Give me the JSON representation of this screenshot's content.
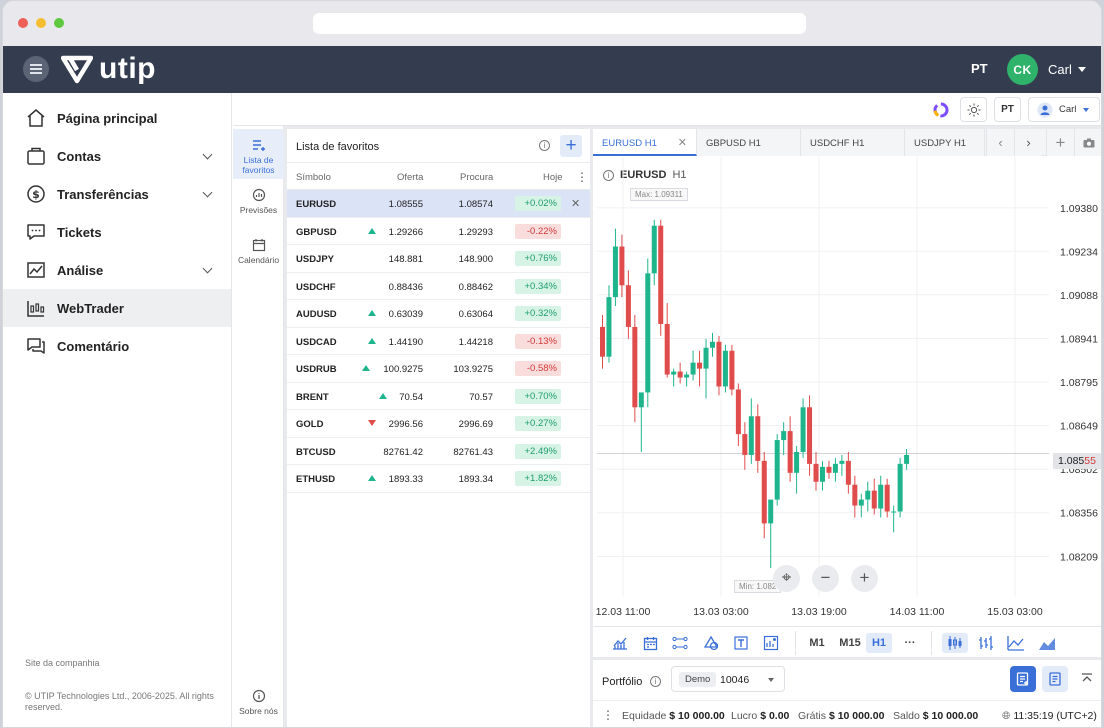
{
  "header": {
    "brand": "utip",
    "lang": "PT",
    "avatar_initials": "CK",
    "user": "Carl"
  },
  "sidebar": {
    "items": [
      {
        "label": "Página principal",
        "icon": "home-icon",
        "expandable": false
      },
      {
        "label": "Contas",
        "icon": "wallet-icon",
        "expandable": true
      },
      {
        "label": "Transferências",
        "icon": "dollar-icon",
        "expandable": true
      },
      {
        "label": "Tickets",
        "icon": "chat-icon",
        "expandable": false
      },
      {
        "label": "Análise",
        "icon": "analytics-icon",
        "expandable": true
      },
      {
        "label": "WebTrader",
        "icon": "webtrader-icon",
        "expandable": false,
        "active": true
      },
      {
        "label": "Comentário",
        "icon": "comment-icon",
        "expandable": false
      }
    ],
    "footer_link": "Site da companhia",
    "copyright": "© UTIP Technologies Ltd., 2006-2025. All rights reserved."
  },
  "topbar": {
    "lang": "PT",
    "user": "Carl"
  },
  "lefttabs": [
    {
      "label": "Lista de favoritos",
      "active": true
    },
    {
      "label": "Previsões"
    },
    {
      "label": "Calendário"
    },
    {
      "label": "Sobre nós"
    }
  ],
  "watchlist": {
    "title": "Lista de favoritos",
    "columns": {
      "symbol": "Símbolo",
      "bid": "Oferta",
      "ask": "Procura",
      "today": "Hoje"
    },
    "rows": [
      {
        "symbol": "EURUSD",
        "bid": "1.08555",
        "ask": "1.08574",
        "change": "+0.02%",
        "dir": "",
        "pos": true,
        "selected": true
      },
      {
        "symbol": "GBPUSD",
        "bid": "1.29266",
        "ask": "1.29293",
        "change": "-0.22%",
        "dir": "up",
        "pos": false
      },
      {
        "symbol": "USDJPY",
        "bid": "148.881",
        "ask": "148.900",
        "change": "+0.76%",
        "dir": "",
        "pos": true
      },
      {
        "symbol": "USDCHF",
        "bid": "0.88436",
        "ask": "0.88462",
        "change": "+0.34%",
        "dir": "",
        "pos": true
      },
      {
        "symbol": "AUDUSD",
        "bid": "0.63039",
        "ask": "0.63064",
        "change": "+0.32%",
        "dir": "up",
        "pos": true
      },
      {
        "symbol": "USDCAD",
        "bid": "1.44190",
        "ask": "1.44218",
        "change": "-0.13%",
        "dir": "up",
        "pos": false
      },
      {
        "symbol": "USDRUB",
        "bid": "100.9275",
        "ask": "103.9275",
        "change": "-0.58%",
        "dir": "up",
        "pos": false
      },
      {
        "symbol": "BRENT",
        "bid": "70.54",
        "ask": "70.57",
        "change": "+0.70%",
        "dir": "up",
        "pos": true
      },
      {
        "symbol": "GOLD",
        "bid": "2996.56",
        "ask": "2996.69",
        "change": "+0.27%",
        "dir": "down",
        "pos": true
      },
      {
        "symbol": "BTCUSD",
        "bid": "82761.42",
        "ask": "82761.43",
        "change": "+2.49%",
        "dir": "",
        "pos": true
      },
      {
        "symbol": "ETHUSD",
        "bid": "1893.33",
        "ask": "1893.34",
        "change": "+1.82%",
        "dir": "up",
        "pos": true
      }
    ]
  },
  "chart": {
    "tabs": [
      "EURUSD H1",
      "GBPUSD H1",
      "USDCHF H1",
      "USDJPY H1"
    ],
    "symbol": "EURUSD",
    "timeframe": "H1",
    "current_price": "1.08555",
    "current_price_main": "1.085",
    "current_price_highlight": "55",
    "max_label": "Max: 1.09311",
    "min_label": "Min: 1.082",
    "timeframes": [
      "M1",
      "M15",
      "H1"
    ],
    "more": "···"
  },
  "chart_data": {
    "type": "candlestick",
    "y_ticks": [
      1.0938,
      1.09234,
      1.09088,
      1.08941,
      1.08795,
      1.08649,
      1.08502,
      1.08356,
      1.08209
    ],
    "y_tick_labels": [
      "1.09380",
      "1.09234",
      "1.09088",
      "1.08941",
      "1.08795",
      "1.08649",
      "1.08502",
      "1.08356",
      "1.08209"
    ],
    "x_ticks": [
      "12.03 11:00",
      "13.03 03:00",
      "13.03 19:00",
      "14.03 11:00",
      "15.03 03:00"
    ],
    "ylim": [
      1.0814,
      1.0945
    ],
    "current": 1.08555,
    "candles": [
      [
        1.0898,
        1.0902,
        1.0884,
        1.0888
      ],
      [
        1.0888,
        1.0912,
        1.0886,
        1.0908
      ],
      [
        1.0908,
        1.0931,
        1.0905,
        1.0925
      ],
      [
        1.0925,
        1.0929,
        1.0908,
        1.0912
      ],
      [
        1.0912,
        1.0917,
        1.0894,
        1.0898
      ],
      [
        1.0898,
        1.0902,
        1.0866,
        1.0871
      ],
      [
        1.0871,
        1.0875,
        1.0856,
        1.0876
      ],
      [
        1.0876,
        1.0921,
        1.0871,
        1.0916
      ],
      [
        1.0916,
        1.0934,
        1.0912,
        1.0932
      ],
      [
        1.0932,
        1.0934,
        1.0895,
        1.0899
      ],
      [
        1.0899,
        1.0906,
        1.0881,
        1.0882
      ],
      [
        1.0882,
        1.0884,
        1.0878,
        1.0883
      ],
      [
        1.0883,
        1.0886,
        1.0879,
        1.0881
      ],
      [
        1.0881,
        1.0883,
        1.0878,
        1.0882
      ],
      [
        1.0882,
        1.089,
        1.088,
        1.0886
      ],
      [
        1.0886,
        1.089,
        1.0878,
        1.0884
      ],
      [
        1.0884,
        1.0894,
        1.0874,
        1.0891
      ],
      [
        1.0891,
        1.0896,
        1.0888,
        1.0893
      ],
      [
        1.0893,
        1.0895,
        1.0875,
        1.0878
      ],
      [
        1.0878,
        1.0892,
        1.0876,
        1.089
      ],
      [
        1.089,
        1.0892,
        1.0875,
        1.0877
      ],
      [
        1.0877,
        1.0879,
        1.0858,
        1.0862
      ],
      [
        1.0862,
        1.0866,
        1.085,
        1.0855
      ],
      [
        1.0855,
        1.0874,
        1.0852,
        1.0868
      ],
      [
        1.0868,
        1.0872,
        1.0849,
        1.0853
      ],
      [
        1.0853,
        1.0856,
        1.0827,
        1.0832
      ],
      [
        1.0832,
        1.0837,
        1.0817,
        1.084
      ],
      [
        1.084,
        1.0862,
        1.0838,
        1.086
      ],
      [
        1.086,
        1.0866,
        1.0855,
        1.0863
      ],
      [
        1.0863,
        1.0868,
        1.0846,
        1.0849
      ],
      [
        1.0849,
        1.0858,
        1.0842,
        1.0856
      ],
      [
        1.0856,
        1.0874,
        1.0854,
        1.0871
      ],
      [
        1.0871,
        1.0875,
        1.0848,
        1.0852
      ],
      [
        1.0852,
        1.0856,
        1.0843,
        1.0846
      ],
      [
        1.0846,
        1.0853,
        1.0843,
        1.0851
      ],
      [
        1.0851,
        1.0853,
        1.0847,
        1.0849
      ],
      [
        1.0849,
        1.0854,
        1.0846,
        1.0852
      ],
      [
        1.0852,
        1.0855,
        1.0848,
        1.0853
      ],
      [
        1.0853,
        1.0856,
        1.0842,
        1.0845
      ],
      [
        1.0845,
        1.0848,
        1.0834,
        1.0838
      ],
      [
        1.0838,
        1.0842,
        1.0834,
        1.084
      ],
      [
        1.084,
        1.0846,
        1.0836,
        1.0843
      ],
      [
        1.0843,
        1.0847,
        1.0835,
        1.0837
      ],
      [
        1.0837,
        1.0848,
        1.0834,
        1.0845
      ],
      [
        1.0845,
        1.0847,
        1.0834,
        1.0836
      ],
      [
        1.0836,
        1.0838,
        1.0829,
        1.0836
      ],
      [
        1.0836,
        1.0854,
        1.0834,
        1.0852
      ],
      [
        1.0852,
        1.0857,
        1.085,
        1.0855
      ]
    ]
  },
  "portfolio": {
    "title": "Portfólio",
    "account_type": "Demo",
    "account": "10046",
    "stats": [
      {
        "label": "Equidade",
        "value": "$ 10 000.00"
      },
      {
        "label": "Lucro",
        "value": "$ 0.00"
      },
      {
        "label": "Grátis",
        "value": "$ 10 000.00"
      },
      {
        "label": "Saldo",
        "value": "$ 10 000.00"
      }
    ],
    "time": "11:35:19 (UTC+2)"
  },
  "colors": {
    "header": "#343d4f",
    "accent": "#3a6fd8",
    "bull": "#1fb58c",
    "bear": "#e04b4b",
    "avatar": "#2fb36b"
  }
}
